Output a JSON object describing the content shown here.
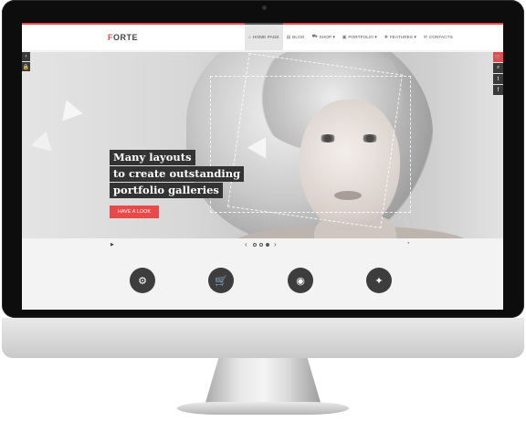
{
  "site": {
    "logo_first": "F",
    "logo_rest": "ORTE"
  },
  "nav": {
    "items": [
      {
        "label": "HOME PAGE",
        "icon": "home-icon",
        "glyph": "⌂"
      },
      {
        "label": "BLOG",
        "icon": "blog-icon",
        "glyph": "▤"
      },
      {
        "label": "SHOP ▾",
        "icon": "cart-icon",
        "glyph": "⛟"
      },
      {
        "label": "PORTFOLIO ▾",
        "icon": "portfolio-icon",
        "glyph": "▣"
      },
      {
        "label": "FEATURES ▾",
        "icon": "features-icon",
        "glyph": "✚"
      },
      {
        "label": "CONTACTS",
        "icon": "envelope-icon",
        "glyph": "✉"
      }
    ],
    "active_index": 0
  },
  "hero": {
    "lines": [
      "Many layouts",
      "to create outstanding",
      "portfolio galleries"
    ],
    "button": "HAVE A LOOK"
  },
  "slider": {
    "play": "▶",
    "prev": "‹",
    "next": "›",
    "loader": "◔",
    "slides_count": 3,
    "current_slide": 3
  },
  "side_left": {
    "items": [
      {
        "icon": "collapse-icon",
        "glyph": "‹"
      },
      {
        "icon": "lock-icon",
        "glyph": "🔒"
      }
    ]
  },
  "side_right": {
    "items": [
      {
        "icon": "cart-icon",
        "glyph": "🛒",
        "badge": "0"
      },
      {
        "icon": "search-icon",
        "glyph": "⌕"
      },
      {
        "icon": "twitter-icon",
        "glyph": "t"
      },
      {
        "icon": "facebook-icon",
        "glyph": "f"
      }
    ]
  },
  "features": [
    {
      "icon": "gears-icon",
      "glyph": "⚙"
    },
    {
      "icon": "cart-icon",
      "glyph": "🛒"
    },
    {
      "icon": "camera-icon",
      "glyph": "◉"
    },
    {
      "icon": "magic-wand-icon",
      "glyph": "✦"
    }
  ],
  "colors": {
    "accent": "#e84a4a",
    "dark": "#333333",
    "header_bg": "#ffffff",
    "screen_bg": "#f3f3f3"
  }
}
